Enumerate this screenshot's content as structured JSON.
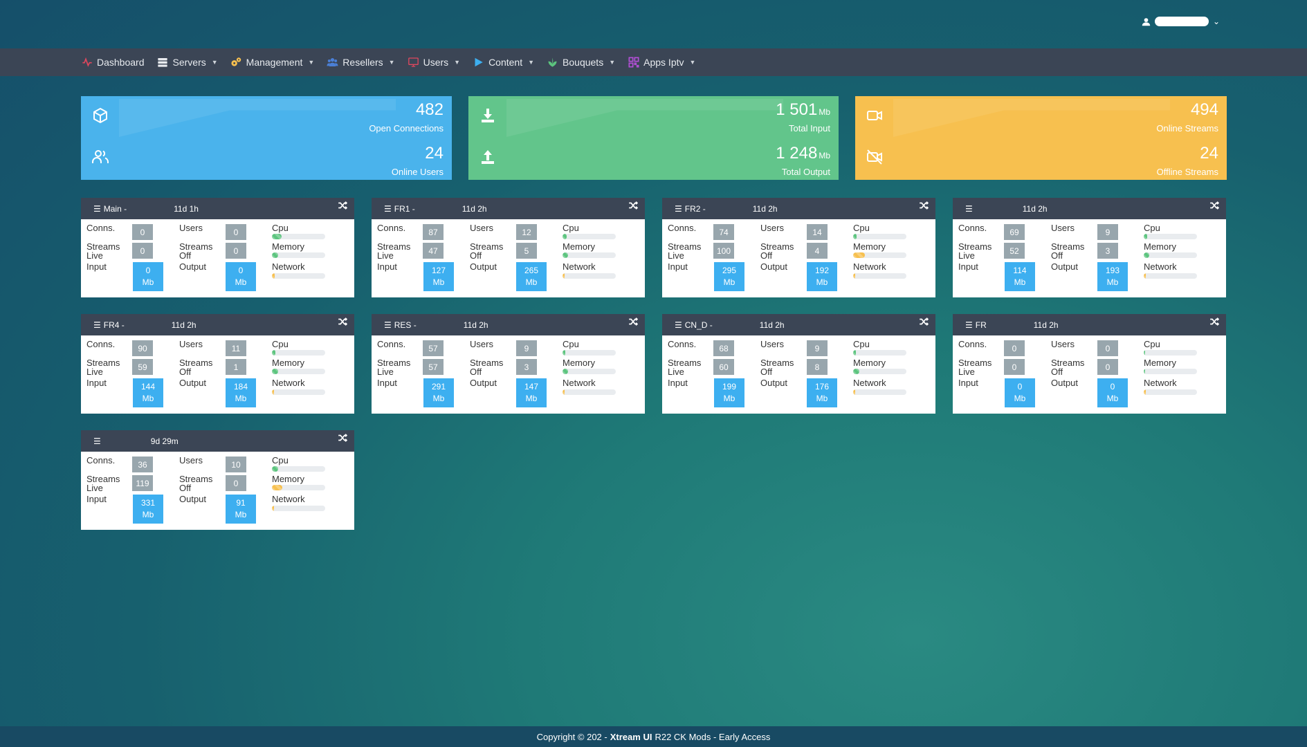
{
  "user": {
    "caret": "⌄"
  },
  "nav": [
    {
      "label": "Dashboard",
      "icon": "activity-icon",
      "color": "#e0475e",
      "caret": false
    },
    {
      "label": "Servers",
      "icon": "server-icon",
      "color": "#e8ebef",
      "caret": true
    },
    {
      "label": "Management",
      "icon": "cogs-icon",
      "color": "#f7c04f",
      "caret": true
    },
    {
      "label": "Resellers",
      "icon": "users-icon",
      "color": "#4a7fd6",
      "caret": true
    },
    {
      "label": "Users",
      "icon": "desktop-icon",
      "color": "#e0475e",
      "caret": true
    },
    {
      "label": "Content",
      "icon": "play-icon",
      "color": "#3daff0",
      "caret": true
    },
    {
      "label": "Bouquets",
      "icon": "leaf-icon",
      "color": "#5cc47e",
      "caret": true
    },
    {
      "label": "Apps Iptv",
      "icon": "qrcode-icon",
      "color": "#b34fd6",
      "caret": true
    }
  ],
  "stats": {
    "connections": {
      "value": "482",
      "label": "Open Connections"
    },
    "online_users": {
      "value": "24",
      "label": "Online Users"
    },
    "total_input": {
      "value": "1 501",
      "unit": "Mb",
      "label": "Total Input"
    },
    "total_output": {
      "value": "1 248",
      "unit": "Mb",
      "label": "Total Output"
    },
    "online_streams": {
      "value": "494",
      "label": "Online Streams"
    },
    "offline_streams": {
      "value": "24",
      "label": "Offline Streams"
    }
  },
  "labels": {
    "conns": "Conns.",
    "users": "Users",
    "cpu": "Cpu",
    "streams": "Streams",
    "live": "Live",
    "off": "Off",
    "memory": "Memory",
    "input": "Input",
    "output": "Output",
    "network": "Network",
    "mb": "Mb"
  },
  "servers": [
    {
      "name": "Main -",
      "uptime": "11d 1h",
      "conns": "0",
      "users": "0",
      "streams_live": "0",
      "streams_off": "0",
      "input": "0",
      "output": "0",
      "cpu": 0.18,
      "memory": 0.12,
      "network": 0.05,
      "mem_color": "green"
    },
    {
      "name": "FR1 -",
      "uptime": "11d 2h",
      "conns": "87",
      "users": "12",
      "streams_live": "47",
      "streams_off": "5",
      "input": "127",
      "output": "265",
      "cpu": 0.08,
      "memory": 0.1,
      "network": 0.04,
      "mem_color": "green"
    },
    {
      "name": "FR2 -",
      "uptime": "11d 2h",
      "conns": "74",
      "users": "14",
      "streams_live": "100",
      "streams_off": "4",
      "input": "295",
      "output": "192",
      "cpu": 0.06,
      "memory": 0.22,
      "network": 0.04,
      "mem_color": "yellow"
    },
    {
      "name": "",
      "uptime": "11d 2h",
      "conns": "69",
      "users": "9",
      "streams_live": "52",
      "streams_off": "3",
      "input": "114",
      "output": "193",
      "cpu": 0.06,
      "memory": 0.1,
      "network": 0.04,
      "mem_color": "green"
    },
    {
      "name": "FR4 -",
      "uptime": "11d 2h",
      "conns": "90",
      "users": "11",
      "streams_live": "59",
      "streams_off": "1",
      "input": "144",
      "output": "184",
      "cpu": 0.06,
      "memory": 0.12,
      "network": 0.04,
      "mem_color": "green"
    },
    {
      "name": "RES -",
      "uptime": "11d 2h",
      "conns": "57",
      "users": "9",
      "streams_live": "57",
      "streams_off": "3",
      "input": "291",
      "output": "147",
      "cpu": 0.05,
      "memory": 0.1,
      "network": 0.04,
      "mem_color": "green"
    },
    {
      "name": "CN_D -",
      "uptime": "11d 2h",
      "conns": "68",
      "users": "9",
      "streams_live": "60",
      "streams_off": "8",
      "input": "199",
      "output": "176",
      "cpu": 0.05,
      "memory": 0.12,
      "network": 0.04,
      "mem_color": "green"
    },
    {
      "name": "FR",
      "uptime": "11d 2h",
      "conns": "0",
      "users": "0",
      "streams_live": "0",
      "streams_off": "0",
      "input": "0",
      "output": "0",
      "cpu": 0.02,
      "memory": 0.02,
      "network": 0.04,
      "mem_color": "green"
    },
    {
      "name": "",
      "uptime": "9d 29m",
      "conns": "36",
      "users": "10",
      "streams_live": "119",
      "streams_off": "0",
      "input": "331",
      "output": "91",
      "cpu": 0.12,
      "memory": 0.2,
      "network": 0.04,
      "mem_color": "yellow"
    }
  ],
  "footer": {
    "prefix": "Copyright © 202",
    "brand": "Xtream UI",
    "suffix": "R22 CK Mods - Early Access"
  },
  "colors": {
    "navbar": "#3b4555",
    "blue": "#4ab3ec",
    "green": "#62c58b",
    "yellow": "#f7c04f",
    "badge": "#98a6ad",
    "io": "#3daff0"
  }
}
